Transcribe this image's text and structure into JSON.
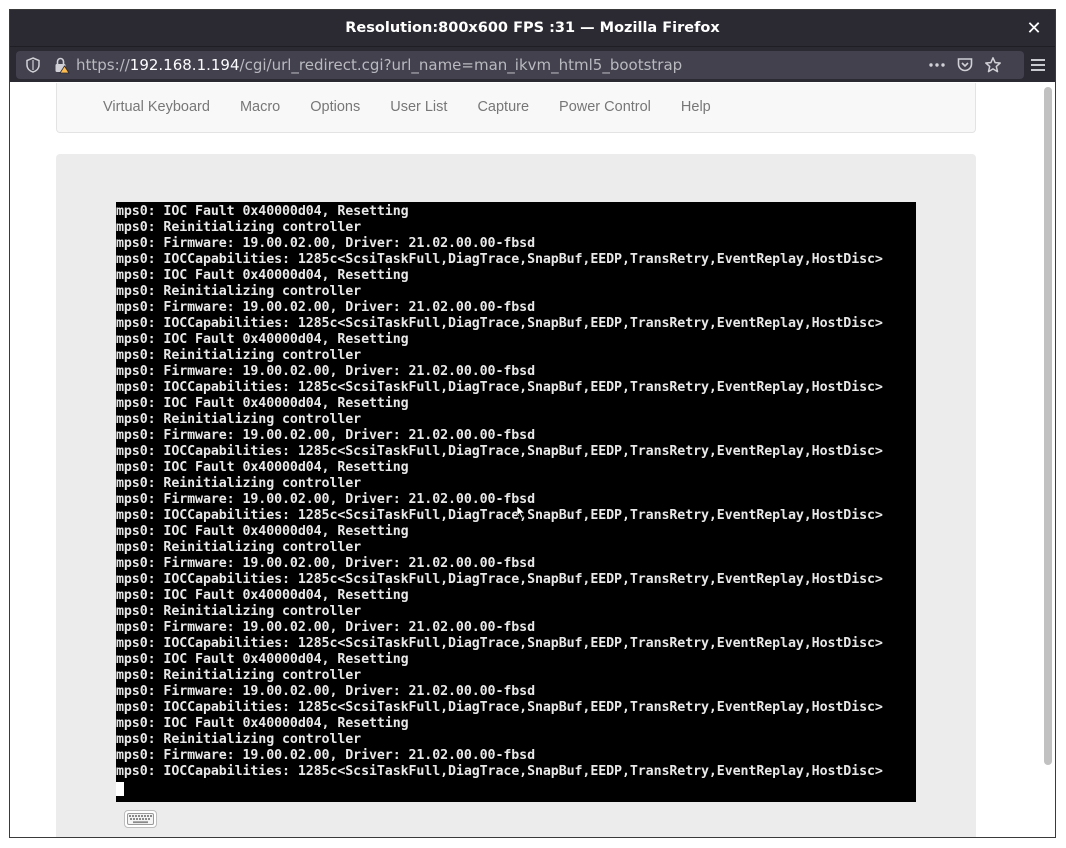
{
  "window": {
    "title": "Resolution:800x600 FPS :31 — Mozilla Firefox",
    "close_glyph": "✕"
  },
  "urlbar": {
    "scheme": "https://",
    "host": "192.168.1.194",
    "path": "/cgi/url_redirect.cgi?url_name=man_ikvm_html5_bootstrap"
  },
  "menu": {
    "items": [
      "Virtual Keyboard",
      "Macro",
      "Options",
      "User List",
      "Capture",
      "Power Control",
      "Help"
    ]
  },
  "console": {
    "lines": [
      "mps0: IOC Fault 0x40000d04, Resetting",
      "mps0: Reinitializing controller",
      "mps0: Firmware: 19.00.02.00, Driver: 21.02.00.00-fbsd",
      "mps0: IOCCapabilities: 1285c<ScsiTaskFull,DiagTrace,SnapBuf,EEDP,TransRetry,EventReplay,HostDisc>",
      "mps0: IOC Fault 0x40000d04, Resetting",
      "mps0: Reinitializing controller",
      "mps0: Firmware: 19.00.02.00, Driver: 21.02.00.00-fbsd",
      "mps0: IOCCapabilities: 1285c<ScsiTaskFull,DiagTrace,SnapBuf,EEDP,TransRetry,EventReplay,HostDisc>",
      "mps0: IOC Fault 0x40000d04, Resetting",
      "mps0: Reinitializing controller",
      "mps0: Firmware: 19.00.02.00, Driver: 21.02.00.00-fbsd",
      "mps0: IOCCapabilities: 1285c<ScsiTaskFull,DiagTrace,SnapBuf,EEDP,TransRetry,EventReplay,HostDisc>",
      "mps0: IOC Fault 0x40000d04, Resetting",
      "mps0: Reinitializing controller",
      "mps0: Firmware: 19.00.02.00, Driver: 21.02.00.00-fbsd",
      "mps0: IOCCapabilities: 1285c<ScsiTaskFull,DiagTrace,SnapBuf,EEDP,TransRetry,EventReplay,HostDisc>",
      "mps0: IOC Fault 0x40000d04, Resetting",
      "mps0: Reinitializing controller",
      "mps0: Firmware: 19.00.02.00, Driver: 21.02.00.00-fbsd",
      "mps0: IOCCapabilities: 1285c<ScsiTaskFull,DiagTrace,SnapBuf,EEDP,TransRetry,EventReplay,HostDisc>",
      "mps0: IOC Fault 0x40000d04, Resetting",
      "mps0: Reinitializing controller",
      "mps0: Firmware: 19.00.02.00, Driver: 21.02.00.00-fbsd",
      "mps0: IOCCapabilities: 1285c<ScsiTaskFull,DiagTrace,SnapBuf,EEDP,TransRetry,EventReplay,HostDisc>",
      "mps0: IOC Fault 0x40000d04, Resetting",
      "mps0: Reinitializing controller",
      "mps0: Firmware: 19.00.02.00, Driver: 21.02.00.00-fbsd",
      "mps0: IOCCapabilities: 1285c<ScsiTaskFull,DiagTrace,SnapBuf,EEDP,TransRetry,EventReplay,HostDisc>",
      "mps0: IOC Fault 0x40000d04, Resetting",
      "mps0: Reinitializing controller",
      "mps0: Firmware: 19.00.02.00, Driver: 21.02.00.00-fbsd",
      "mps0: IOCCapabilities: 1285c<ScsiTaskFull,DiagTrace,SnapBuf,EEDP,TransRetry,EventReplay,HostDisc>",
      "mps0: IOC Fault 0x40000d04, Resetting",
      "mps0: Reinitializing controller",
      "mps0: Firmware: 19.00.02.00, Driver: 21.02.00.00-fbsd",
      "mps0: IOCCapabilities: 1285c<ScsiTaskFull,DiagTrace,SnapBuf,EEDP,TransRetry,EventReplay,HostDisc>"
    ]
  },
  "icons": {
    "shield": "shield-icon",
    "lock": "lock-warning-icon",
    "more": "more-dots-icon",
    "pocket": "pocket-icon",
    "bookmark": "star-icon",
    "menu": "hamburger-menu-icon",
    "keyboard": "keyboard-icon"
  },
  "colors": {
    "chrome": "#2b2a33",
    "urlbar": "#42414d",
    "console_bg": "#000000",
    "console_fg": "#e8e8e8",
    "well": "#ececec"
  }
}
